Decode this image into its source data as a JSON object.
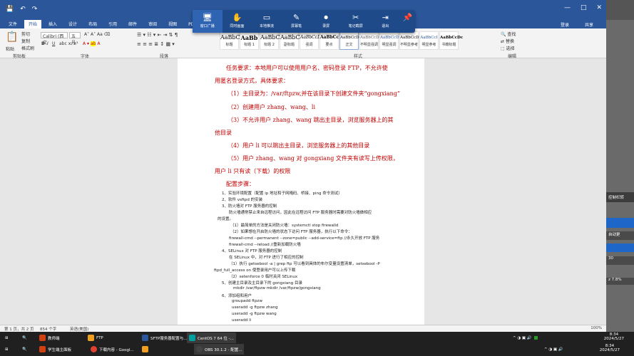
{
  "titlebar": {
    "icons": [
      "save-icon",
      "undo-icon",
      "redo-icon"
    ],
    "window_controls": [
      "—",
      "□",
      "✕"
    ]
  },
  "menu": {
    "tabs": [
      "文件",
      "开始",
      "插入",
      "设计",
      "布局",
      "引用",
      "邮件",
      "审阅",
      "视图",
      "PDF工具集"
    ],
    "active_index": 1,
    "share": "共享",
    "login": "登录"
  },
  "ribbon": {
    "paste": "粘贴",
    "cut": "剪切",
    "copy": "复制",
    "format_painter": "格式刷",
    "clipboard_group": "剪贴板",
    "font_group": "字体",
    "paragraph_group": "段落",
    "styles_group": "样式",
    "editing_group": "编辑",
    "font_name": "Calibri (西文",
    "font_size": "五号",
    "find": "查找",
    "replace": "替换",
    "select": "选择",
    "styles": [
      {
        "sample": "AaBbC",
        "name": "标题"
      },
      {
        "sample": "AaBb",
        "name": "标题 1"
      },
      {
        "sample": "AaBbC",
        "name": "标题 2"
      },
      {
        "sample": "AaBbC",
        "name": "副标题"
      },
      {
        "sample": "AaBbCcD",
        "name": "强调"
      },
      {
        "sample": "AaBbCcD",
        "name": "要点"
      },
      {
        "sample": "AaBbCcDd",
        "name": "正文"
      },
      {
        "sample": "AaBbCcDd",
        "name": "不明显强调"
      },
      {
        "sample": "AaBbCcD",
        "name": "明显强调"
      },
      {
        "sample": "AaBbCcD",
        "name": "不明显参考"
      },
      {
        "sample": "AaBbCcI",
        "name": "明显参考"
      },
      {
        "sample": "AaBbCcDc",
        "name": "书籍标题"
      }
    ]
  },
  "overlay": {
    "items": [
      "窗口广播",
      "同时画面",
      "本地推流",
      "屏幕笔",
      "录屏",
      "笔记截屏",
      "退出"
    ]
  },
  "document": {
    "lines": [
      "任务要求：本地用户可以使用用户名、密码登录 FTP，不允许使",
      "用匿名登录方式，具体要求：",
      "（1）主目录为：/var/ftpzw,并在该目录下创建文件夹“gongxiang”",
      "（2）创建用户 zhang、wang、li",
      "（3）不允许用户 zhang、wang 跳出主目录，浏览服务器上的其",
      "他目录",
      "（4）用户 li 可以跳出主目录，浏览服务器上的其他目录",
      "（5）用户 zhang、wang 对 gongxiang 文件夹有读写上传权限，",
      "用户 li 只有读（下载）的权限",
      "配置步骤："
    ],
    "steps": [
      "1、实验环境配置（配置 ip 地址和子网掩码、桥接、ping 命令测试）",
      "2、软件 vsftpd 的安装",
      "3、防火墙对 FTP 服务器的控制",
      "防火墙通常禁止来自远程访问，因此在远程访问 FTP 服务器时需要对防火墙做相应",
      "的设置。",
      "（1）最简单的方法是关闭防火墙：systemctl stop firewalld",
      "（2）如果想在开启防火墙的状态下访问 FTP 服务器，执行以下命令：",
      "firewall-cmd --permanent --zone=public --add-service=ftp    //永久开放 FTP 服务",
      "firewall-cmd --reload //重新加载防火墙",
      "4、SELinux 对 FTP 服务器的控制",
      "在 SELinux 中，对 FTP 进行了相应的控制",
      "（1）执行 getsebool -a | grep ftp 可以看到具体的布尔变量设置清单，setsebool -P",
      "ftpd_full_access on 使登录用户可以上传下载",
      "（2）setenforce 0 临时关闭 SELinux",
      "5、创建主目录及主目录下的 gongxiang 目录",
      "mkdir /var/ftpzw     mkdir /var/ftpzw/gongxiang",
      "6、添加组和用户",
      "groupadd ftpzw",
      "useradd -g ftpzw zhang",
      "useradd -g ftpzw wang",
      "useradd li"
    ]
  },
  "status": {
    "page": "第 1 页，共 2 页",
    "words": "854 个字",
    "lang": "英语(美国)",
    "zoom": "100%"
  },
  "right_panel": {
    "title": "控制栏转",
    "item2": "自动更",
    "item3": "30",
    "stat": "z 7.8%"
  },
  "taskbar": {
    "row1": [
      "教师端",
      "FTP",
      "SFTP服务器配置与...",
      "CentOS 7 64 位 -..."
    ],
    "row2": [
      "学生端主面板",
      "下载内容 - Googl...",
      "",
      "OBS 30.1.2 - 配置..."
    ],
    "time": "8:34",
    "date": "2024/5/27",
    "time2": "8:34",
    "date2": "2024/5/27"
  }
}
